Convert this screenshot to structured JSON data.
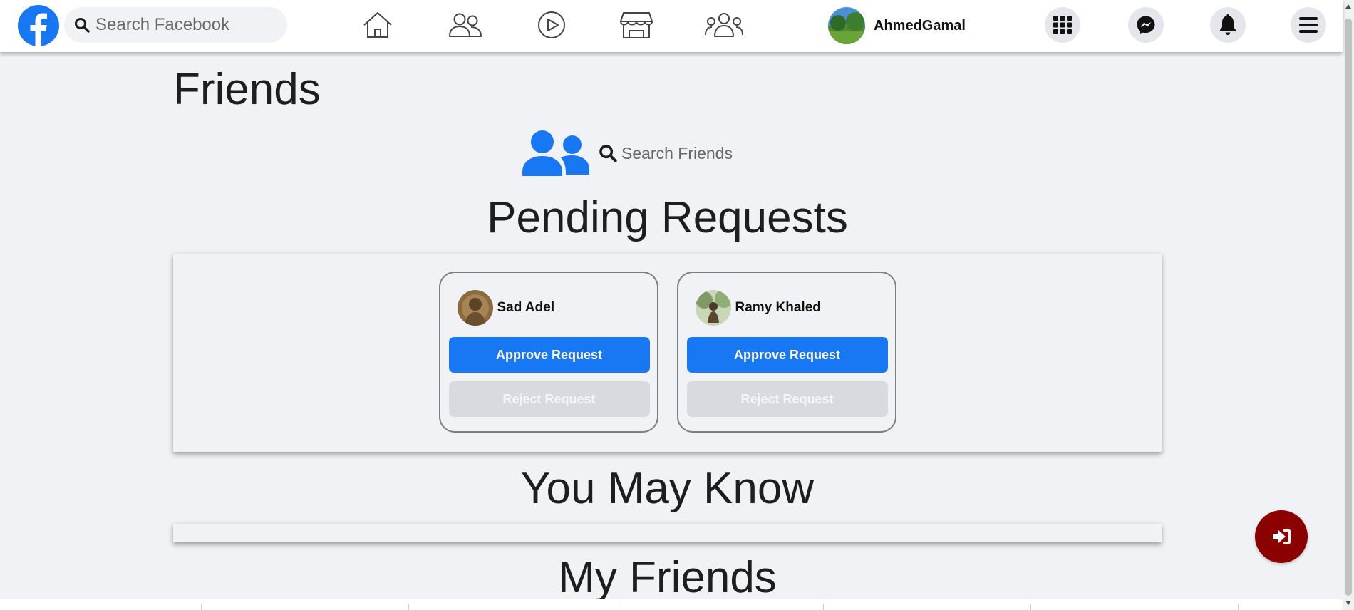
{
  "header": {
    "search_placeholder": "Search Facebook",
    "nav_icons": [
      "home-icon",
      "friends-icon",
      "watch-icon",
      "marketplace-icon",
      "groups-icon"
    ],
    "profile_name": "AhmedGamal",
    "action_icons": [
      "menu-grid-icon",
      "messenger-icon",
      "bell-icon",
      "hamburger-icon"
    ]
  },
  "main": {
    "page_title": "Friends",
    "friends_search_placeholder": "Search Friends",
    "pending_title": "Pending Requests",
    "pending_requests": [
      {
        "name": "Sad Adel",
        "approve_label": "Approve Request",
        "reject_label": "Reject Request"
      },
      {
        "name": "Ramy Khaled",
        "approve_label": "Approve Request",
        "reject_label": "Reject Request"
      }
    ],
    "you_may_know_title": "You May Know",
    "my_friends_title": "My Friends"
  },
  "colors": {
    "brand": "#1877f2",
    "background": "#f0f2f5",
    "logout": "#8b0000",
    "reject_button": "#d8dadf"
  },
  "fab": {
    "icon": "sign-out-icon"
  }
}
